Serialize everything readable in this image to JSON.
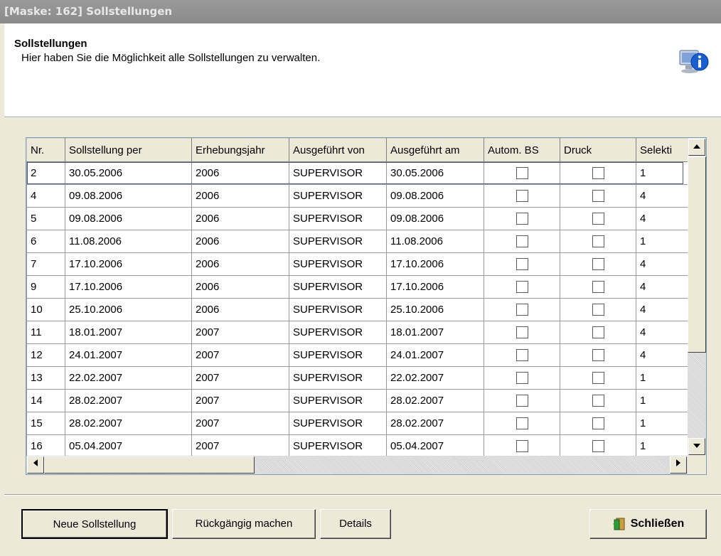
{
  "window": {
    "title": "[Maske: 162] Sollstellungen"
  },
  "header": {
    "title": "Sollstellungen",
    "subtitle": "Hier haben Sie die Möglichkeit alle Sollstellungen zu verwalten."
  },
  "grid": {
    "columns": [
      "Nr.",
      "Sollstellung per",
      "Erhebungsjahr",
      "Ausgeführt von",
      "Ausgeführt am",
      "Autom. BS",
      "Druck",
      "Selekti"
    ],
    "rows": [
      {
        "nr": "2",
        "per": "30.05.2006",
        "jahr": "2006",
        "von": "SUPERVISOR",
        "am": "30.05.2006",
        "autom": false,
        "druck": false,
        "sel": "1"
      },
      {
        "nr": "4",
        "per": "09.08.2006",
        "jahr": "2006",
        "von": "SUPERVISOR",
        "am": "09.08.2006",
        "autom": false,
        "druck": false,
        "sel": "4"
      },
      {
        "nr": "5",
        "per": "09.08.2006",
        "jahr": "2006",
        "von": "SUPERVISOR",
        "am": "09.08.2006",
        "autom": false,
        "druck": false,
        "sel": "4"
      },
      {
        "nr": "6",
        "per": "11.08.2006",
        "jahr": "2006",
        "von": "SUPERVISOR",
        "am": "11.08.2006",
        "autom": false,
        "druck": false,
        "sel": "1"
      },
      {
        "nr": "7",
        "per": "17.10.2006",
        "jahr": "2006",
        "von": "SUPERVISOR",
        "am": "17.10.2006",
        "autom": false,
        "druck": false,
        "sel": "4"
      },
      {
        "nr": "9",
        "per": "17.10.2006",
        "jahr": "2006",
        "von": "SUPERVISOR",
        "am": "17.10.2006",
        "autom": false,
        "druck": false,
        "sel": "4"
      },
      {
        "nr": "10",
        "per": "25.10.2006",
        "jahr": "2006",
        "von": "SUPERVISOR",
        "am": "25.10.2006",
        "autom": false,
        "druck": false,
        "sel": "4"
      },
      {
        "nr": "11",
        "per": "18.01.2007",
        "jahr": "2007",
        "von": "SUPERVISOR",
        "am": "18.01.2007",
        "autom": false,
        "druck": false,
        "sel": "4"
      },
      {
        "nr": "12",
        "per": "24.01.2007",
        "jahr": "2007",
        "von": "SUPERVISOR",
        "am": "24.01.2007",
        "autom": false,
        "druck": false,
        "sel": "4"
      },
      {
        "nr": "13",
        "per": "22.02.2007",
        "jahr": "2007",
        "von": "SUPERVISOR",
        "am": "22.02.2007",
        "autom": false,
        "druck": false,
        "sel": "1"
      },
      {
        "nr": "14",
        "per": "28.02.2007",
        "jahr": "2007",
        "von": "SUPERVISOR",
        "am": "28.02.2007",
        "autom": false,
        "druck": false,
        "sel": "1"
      },
      {
        "nr": "15",
        "per": "28.02.2007",
        "jahr": "2007",
        "von": "SUPERVISOR",
        "am": "28.02.2007",
        "autom": false,
        "druck": false,
        "sel": "1"
      },
      {
        "nr": "16",
        "per": "05.04.2007",
        "jahr": "2007",
        "von": "SUPERVISOR",
        "am": "05.04.2007",
        "autom": false,
        "druck": false,
        "sel": "1"
      }
    ]
  },
  "buttons": {
    "new": "Neue Sollstellung",
    "undo": "Rückgängig machen",
    "details": "Details",
    "close": "Schließen"
  },
  "icons": {
    "header": "info-icon",
    "close": "exit-door-icon"
  }
}
